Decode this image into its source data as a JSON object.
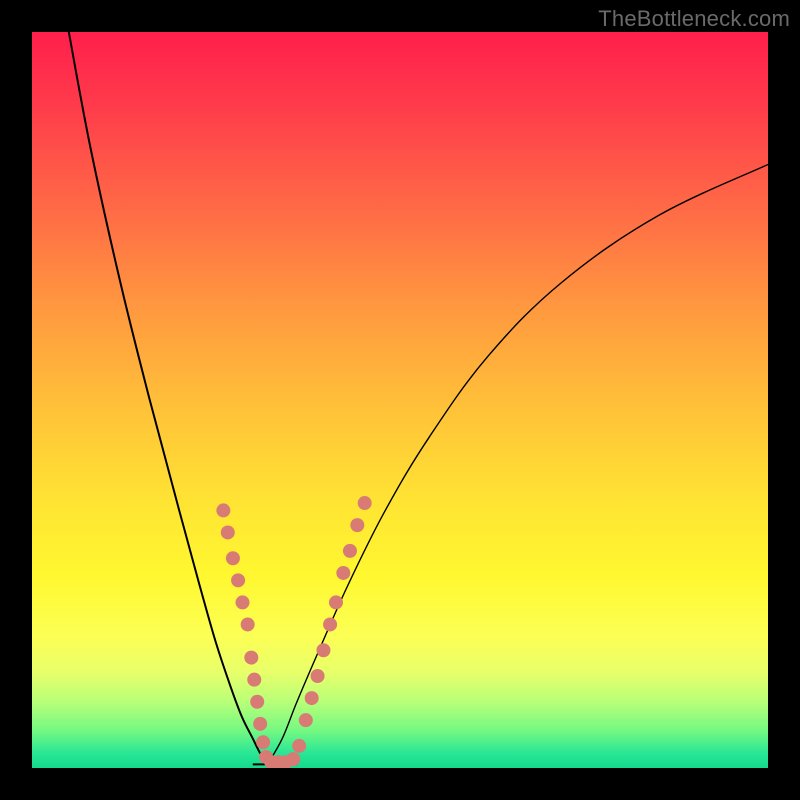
{
  "watermark": "TheBottleneck.com",
  "chart_data": {
    "type": "line",
    "title": "",
    "xlabel": "",
    "ylabel": "",
    "xlim": [
      0,
      100
    ],
    "ylim": [
      0,
      100
    ],
    "series": [
      {
        "name": "left-curve",
        "x": [
          5,
          8,
          12,
          16,
          20,
          23,
          25,
          27,
          28.5,
          30,
          31,
          32
        ],
        "y": [
          100,
          84,
          66,
          50,
          35,
          24,
          17,
          11,
          7,
          4,
          2,
          0.5
        ]
      },
      {
        "name": "right-curve",
        "x": [
          32,
          34,
          36,
          39,
          43,
          48,
          54,
          62,
          72,
          85,
          100
        ],
        "y": [
          0.5,
          4,
          9,
          16,
          25,
          35,
          45,
          56,
          66,
          75,
          82
        ]
      },
      {
        "name": "bottom-flat",
        "x": [
          30,
          36
        ],
        "y": [
          0.5,
          0.5
        ]
      }
    ],
    "markers": {
      "name": "overlay-dots",
      "points": [
        {
          "x": 26.0,
          "y": 35.0
        },
        {
          "x": 26.6,
          "y": 32.0
        },
        {
          "x": 27.3,
          "y": 28.5
        },
        {
          "x": 28.0,
          "y": 25.5
        },
        {
          "x": 28.6,
          "y": 22.5
        },
        {
          "x": 29.3,
          "y": 19.5
        },
        {
          "x": 29.8,
          "y": 15.0
        },
        {
          "x": 30.2,
          "y": 12.0
        },
        {
          "x": 30.6,
          "y": 9.0
        },
        {
          "x": 31.0,
          "y": 6.0
        },
        {
          "x": 31.4,
          "y": 3.5
        },
        {
          "x": 31.8,
          "y": 1.5
        },
        {
          "x": 32.5,
          "y": 0.8
        },
        {
          "x": 33.5,
          "y": 0.8
        },
        {
          "x": 34.5,
          "y": 0.8
        },
        {
          "x": 35.5,
          "y": 1.2
        },
        {
          "x": 36.3,
          "y": 3.0
        },
        {
          "x": 37.2,
          "y": 6.5
        },
        {
          "x": 38.0,
          "y": 9.5
        },
        {
          "x": 38.8,
          "y": 12.5
        },
        {
          "x": 39.6,
          "y": 16.0
        },
        {
          "x": 40.5,
          "y": 19.5
        },
        {
          "x": 41.3,
          "y": 22.5
        },
        {
          "x": 42.3,
          "y": 26.5
        },
        {
          "x": 43.2,
          "y": 29.5
        },
        {
          "x": 44.2,
          "y": 33.0
        },
        {
          "x": 45.2,
          "y": 36.0
        }
      ],
      "radius": 7
    },
    "gradient_stops": [
      {
        "pos": 0.0,
        "color": "#ff1f4b"
      },
      {
        "pos": 0.5,
        "color": "#ffd936"
      },
      {
        "pos": 0.85,
        "color": "#fbff4c"
      },
      {
        "pos": 1.0,
        "color": "#16d98c"
      }
    ]
  }
}
